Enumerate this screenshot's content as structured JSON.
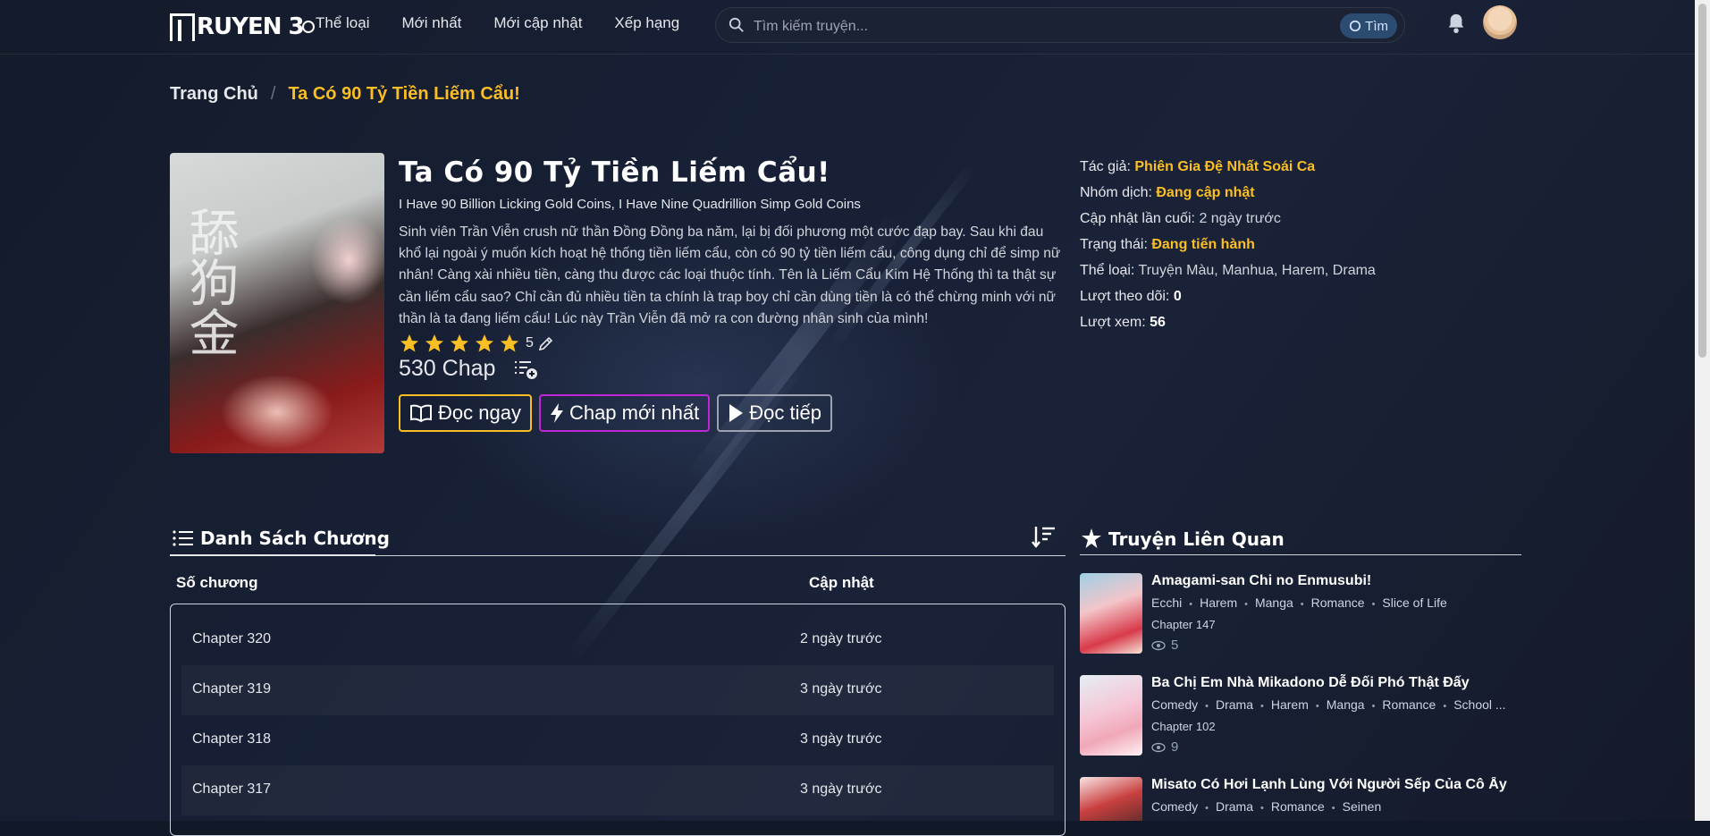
{
  "header": {
    "logo_text": "RUYEN 3",
    "nav": [
      "Thể loại",
      "Mới nhất",
      "Mới cập nhật",
      "Xếp hạng"
    ],
    "search_placeholder": "Tìm kiếm truyện...",
    "search_button": "Tìm"
  },
  "breadcrumb": {
    "home": "Trang Chủ",
    "separator": "/",
    "current": "Ta Có 90 Tỷ Tiền Liếm Cẩu!"
  },
  "comic": {
    "cover_cjk": "舔狗金",
    "title": "Ta Có 90 Tỷ Tiền Liếm Cẩu!",
    "alt_title": "I Have 90 Billion Licking Gold Coins, I Have Nine Quadrillion Simp Gold Coins",
    "description": "Sinh viên Trần Viễn crush nữ thần Đồng Đồng ba năm, lại bị đối phương một cước đạp bay. Sau khi đau khổ lại ngoài ý muốn kích hoạt hệ thống tiền liếm cẩu, còn có 90 tỷ tiền liếm cẩu, công dụng chỉ để simp nữ nhân! Càng xài nhiều tiền, càng thu được các loại thuộc tính. Tên là Liếm Cẩu Kim Hệ Thống thì ta thật sự cần liếm cẩu sao? Chỉ cần đủ nhiều tiền ta chính là trap boy chỉ cần dùng tiền là có thể chừng minh với nữ thần là ta đang liếm cẩu! Lúc này Trần Viễn đã mở ra con đường nhân sinh của mình!",
    "rating": 5,
    "rating_text": "5",
    "chap_count": "530 Chap",
    "buttons": {
      "read_now": "Đọc ngay",
      "newest": "Chap mới nhất",
      "continue": "Đọc tiếp"
    }
  },
  "info": {
    "author_label": "Tác giả:",
    "author": "Phiên Gia Đệ Nhất Soái Ca",
    "group_label": "Nhóm dịch:",
    "group": "Đang cập nhật",
    "updated_label": "Cập nhật lần cuối:",
    "updated": "2 ngày trước",
    "status_label": "Trạng thái:",
    "status": "Đang tiến hành",
    "genre_label": "Thể loại:",
    "genres": "Truyện Màu, Manhua, Harem, Drama",
    "follows_label": "Lượt theo dõi:",
    "follows": "0",
    "views_label": "Lượt xem:",
    "views": "56"
  },
  "chapters": {
    "heading": "Danh Sách Chương",
    "col_number": "Số chương",
    "col_updated": "Cập nhật",
    "rows": [
      {
        "name": "Chapter 320",
        "date": "2 ngày trước"
      },
      {
        "name": "Chapter 319",
        "date": "3 ngày trước"
      },
      {
        "name": "Chapter 318",
        "date": "3 ngày trước"
      },
      {
        "name": "Chapter 317",
        "date": "3 ngày trước"
      }
    ]
  },
  "related": {
    "heading": "Truyện Liên Quan",
    "items": [
      {
        "title": "Amagami-san Chi no Enmusubi!",
        "tags": [
          "Ecchi",
          "Harem",
          "Manga",
          "Romance",
          "Slice of Life"
        ],
        "chapter": "Chapter 147",
        "views": "5"
      },
      {
        "title": "Ba Chị Em Nhà Mikadono Dễ Đối Phó Thật Đấy",
        "tags": [
          "Comedy",
          "Drama",
          "Harem",
          "Manga",
          "Romance",
          "School ..."
        ],
        "chapter": "Chapter 102",
        "views": "9"
      },
      {
        "title": "Misato Có Hơi Lạnh Lùng Với Người Sếp Của Cô Ấy",
        "tags": [
          "Comedy",
          "Drama",
          "Romance",
          "Seinen"
        ],
        "chapter": "",
        "views": ""
      }
    ]
  },
  "colors": {
    "accent": "#fbbf24",
    "bg": "#111827",
    "newest_border": "#c026d3"
  }
}
